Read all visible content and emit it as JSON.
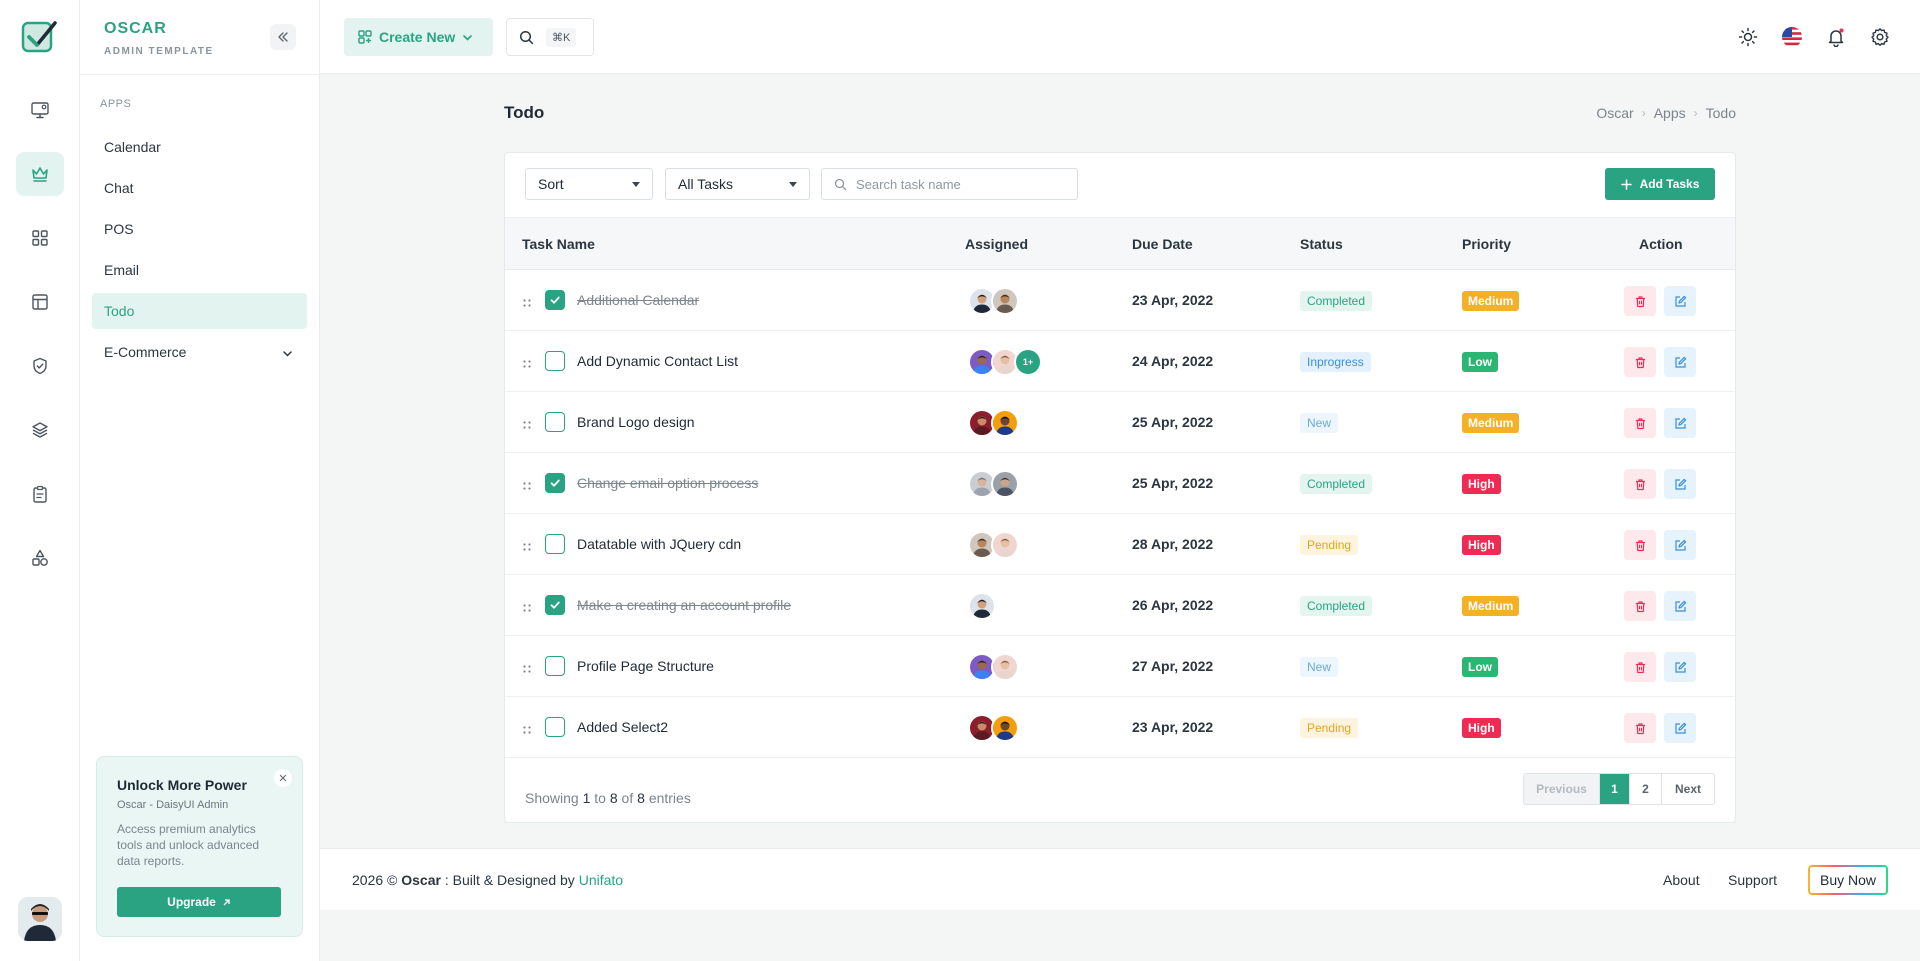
{
  "brand": {
    "name": "OSCAR",
    "tagline": "ADMIN TEMPLATE"
  },
  "colors": {
    "accent": "#2aa383",
    "danger": "#ef2b54",
    "warning": "#f4b125",
    "success": "#2bb673",
    "info": "#3a8ed9"
  },
  "rail": {
    "icons": [
      "monitor-icon",
      "crown-icon",
      "apps-grid-icon",
      "layout-icon",
      "shield-check-icon",
      "layers-icon",
      "clipboard-icon",
      "shapes-icon"
    ],
    "active": "crown-icon"
  },
  "sidebar": {
    "section": "APPS",
    "items": [
      {
        "label": "Calendar"
      },
      {
        "label": "Chat"
      },
      {
        "label": "POS"
      },
      {
        "label": "Email"
      },
      {
        "label": "Todo",
        "active": true
      },
      {
        "label": "E-Commerce",
        "expandable": true
      }
    ],
    "promo": {
      "title": "Unlock More Power",
      "subtitle": "Oscar - DaisyUI Admin",
      "description": "Access premium analytics tools and unlock advanced data reports.",
      "button": "Upgrade",
      "close": "✕"
    }
  },
  "topbar": {
    "create_label": "Create New",
    "shortcut": "⌘K",
    "icons": [
      "sun-icon",
      "us-flag-icon",
      "bell-icon",
      "settings-icon"
    ]
  },
  "page": {
    "title": "Todo",
    "breadcrumb": [
      "Oscar",
      "Apps",
      "Todo"
    ]
  },
  "filters": {
    "sort": "Sort",
    "task_filter": "All Tasks",
    "search_placeholder": "Search task name",
    "add_button": "Add Tasks"
  },
  "table": {
    "columns": [
      "Task Name",
      "Assigned",
      "Due Date",
      "Status",
      "Priority",
      "Action"
    ],
    "rows": [
      {
        "name": "Additional Calendar",
        "done": true,
        "avatars": [
          "a1",
          "a2"
        ],
        "extra": "",
        "due": "23 Apr, 2022",
        "status": "Completed",
        "priority": "Medium"
      },
      {
        "name": "Add Dynamic Contact List",
        "done": false,
        "avatars": [
          "a3",
          "a4"
        ],
        "extra": "1+",
        "due": "24 Apr, 2022",
        "status": "Inprogress",
        "priority": "Low"
      },
      {
        "name": "Brand Logo design",
        "done": false,
        "avatars": [
          "a5",
          "a6"
        ],
        "extra": "",
        "due": "25 Apr, 2022",
        "status": "New",
        "priority": "Medium"
      },
      {
        "name": "Change email option process",
        "done": true,
        "avatars": [
          "a7",
          "a8"
        ],
        "extra": "",
        "due": "25 Apr, 2022",
        "status": "Completed",
        "priority": "High"
      },
      {
        "name": "Datatable with JQuery cdn",
        "done": false,
        "avatars": [
          "a2",
          "a4"
        ],
        "extra": "",
        "due": "28 Apr, 2022",
        "status": "Pending",
        "priority": "High"
      },
      {
        "name": "Make a creating an account profile",
        "done": true,
        "avatars": [
          "a1"
        ],
        "extra": "",
        "due": "26 Apr, 2022",
        "status": "Completed",
        "priority": "Medium"
      },
      {
        "name": "Profile Page Structure",
        "done": false,
        "avatars": [
          "a3",
          "a4"
        ],
        "extra": "",
        "due": "27 Apr, 2022",
        "status": "New",
        "priority": "Low"
      },
      {
        "name": "Added Select2",
        "done": false,
        "avatars": [
          "a5",
          "a6"
        ],
        "extra": "",
        "due": "23 Apr, 2022",
        "status": "Pending",
        "priority": "High"
      }
    ],
    "showing": {
      "prefix": "Showing",
      "from": "1",
      "to_word": "to",
      "to": "8",
      "of_word": "of",
      "total": "8",
      "suffix": "entries"
    },
    "pagination": {
      "previous": "Previous",
      "pages": [
        "1",
        "2"
      ],
      "current": "1",
      "next": "Next"
    }
  },
  "footer": {
    "year": "2026 ©",
    "brand": "Oscar",
    "text": ": Built & Designed by",
    "company": "Unifato",
    "links": [
      "About",
      "Support"
    ],
    "buy": "Buy Now"
  }
}
